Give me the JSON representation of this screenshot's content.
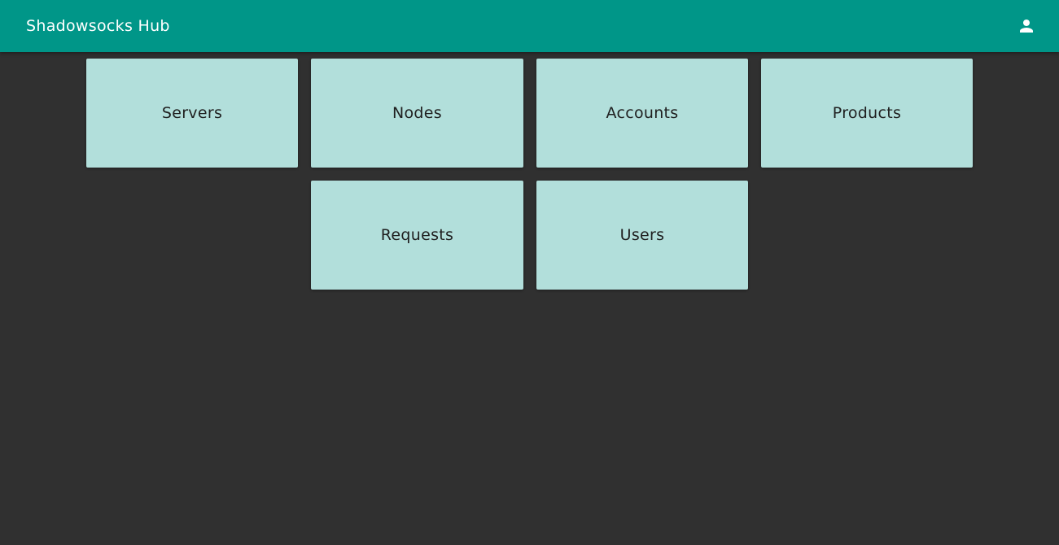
{
  "header": {
    "title": "Shadowsocks Hub",
    "account_icon": "person-icon"
  },
  "colors": {
    "toolbar": "#009688",
    "background": "#303030",
    "tile": "#b2dfdb"
  },
  "tiles": [
    {
      "label": "Servers"
    },
    {
      "label": "Nodes"
    },
    {
      "label": "Accounts"
    },
    {
      "label": "Products"
    },
    {
      "label": "Requests"
    },
    {
      "label": "Users"
    }
  ]
}
